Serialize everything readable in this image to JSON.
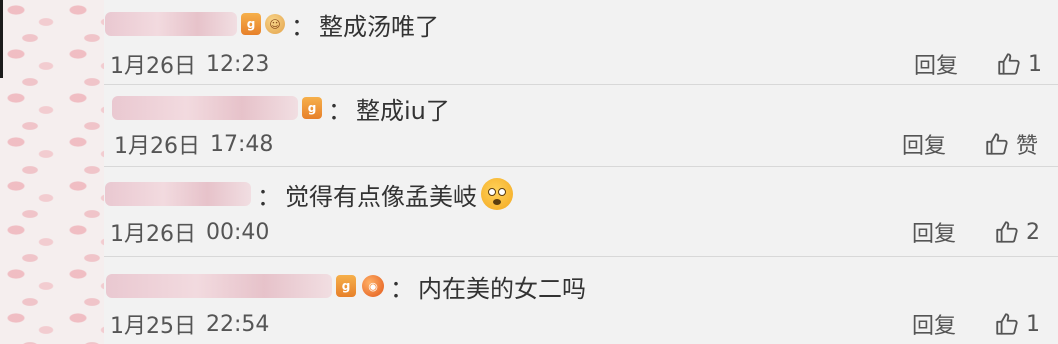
{
  "comments": [
    {
      "text": "整成汤唯了",
      "date": "1月26日",
      "time": "12:23",
      "reply_label": "回复",
      "like_count": "1",
      "badge_text": "g",
      "emoji_text": "☺"
    },
    {
      "text": "整成iu了",
      "date": "1月26日",
      "time": "17:48",
      "reply_label": "回复",
      "like_count": "赞",
      "badge_text": "g"
    },
    {
      "text": "觉得有点像孟美岐",
      "date": "1月26日",
      "time": "00:40",
      "reply_label": "回复",
      "like_count": "2"
    },
    {
      "text": "内在美的女二吗",
      "date": "1月25日",
      "time": "22:54",
      "reply_label": "回复",
      "like_count": "1",
      "badge_text": "g",
      "emoji_text": "◉"
    }
  ],
  "colors": {
    "background": "#f2f2f2",
    "text": "#333333",
    "meta": "#555555",
    "badge": "#e7802a"
  },
  "icons": {
    "like": "thumbs-up-icon",
    "badge": "vip-badge-icon",
    "emoji": "emoji-face-icon"
  },
  "colon": "："
}
